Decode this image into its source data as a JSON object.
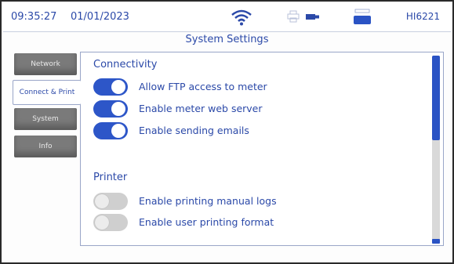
{
  "status_bar": {
    "time": "09:35:27",
    "date": "01/01/2023",
    "model": "HI6221",
    "icons": [
      "wifi-icon",
      "printer-icon",
      "usb-icon",
      "battery-icon"
    ]
  },
  "title": "System Settings",
  "tabs": [
    {
      "label": "Network",
      "active": false
    },
    {
      "label": "Connect & Print",
      "active": true
    },
    {
      "label": "System",
      "active": false
    },
    {
      "label": "Info",
      "active": false
    }
  ],
  "sections": {
    "connectivity": {
      "title": "Connectivity",
      "items": [
        {
          "label": "Allow FTP access to meter",
          "enabled": true
        },
        {
          "label": "Enable meter web server",
          "enabled": true
        },
        {
          "label": "Enable sending emails",
          "enabled": true
        }
      ]
    },
    "printer": {
      "title": "Printer",
      "items": [
        {
          "label": "Enable printing manual logs",
          "enabled": false
        },
        {
          "label": "Enable user printing format",
          "enabled": false
        }
      ]
    }
  },
  "colors": {
    "accent": "#2d56c8",
    "text": "#2b49a8",
    "tab_inactive": "#7a7a7a",
    "toggle_off": "#cfcfcf"
  }
}
